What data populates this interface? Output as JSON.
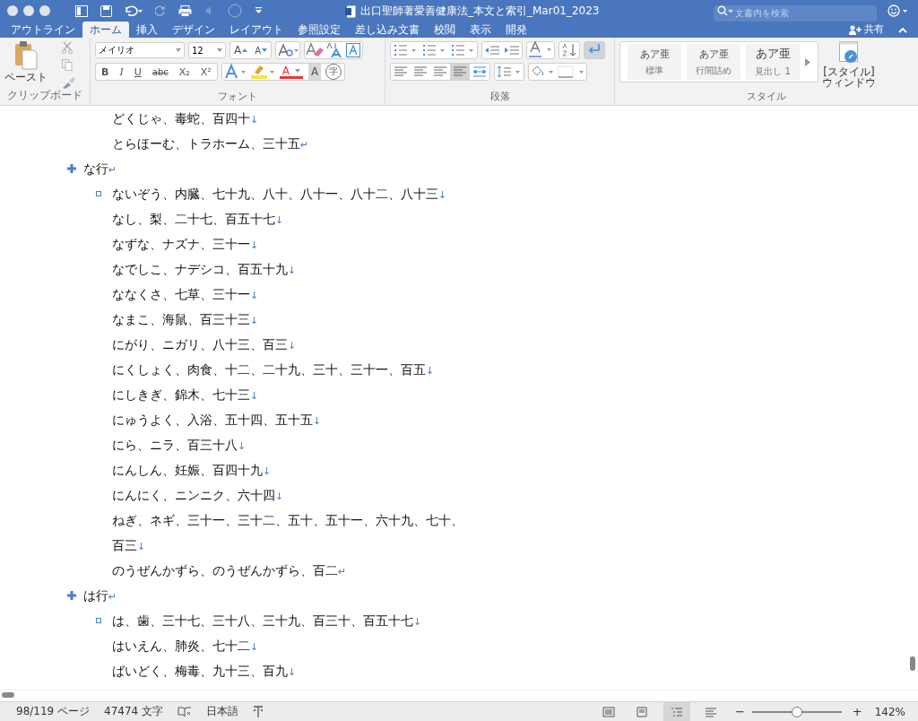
{
  "window": {
    "title": "出口聖師著愛善健康法_本文と索引_Mar01_2023",
    "search_placeholder": "文書内を検索"
  },
  "tabs": [
    {
      "label": "アウトライン",
      "selected": false
    },
    {
      "label": "ホーム",
      "selected": true
    },
    {
      "label": "挿入",
      "selected": false
    },
    {
      "label": "デザイン",
      "selected": false
    },
    {
      "label": "レイアウト",
      "selected": false
    },
    {
      "label": "参照設定",
      "selected": false
    },
    {
      "label": "差し込み文書",
      "selected": false
    },
    {
      "label": "校閲",
      "selected": false
    },
    {
      "label": "表示",
      "selected": false
    },
    {
      "label": "開発",
      "selected": false
    }
  ],
  "share": "共有",
  "ribbon": {
    "clipboard": {
      "paste": "ペースト",
      "label": "クリップボード"
    },
    "font": {
      "name": "メイリオ",
      "size": "12",
      "grow": "A",
      "shrink": "A",
      "buttons": [
        "B",
        "I",
        "U",
        "abc",
        "X₂",
        "X²"
      ],
      "color_a": "A",
      "shade_a": "A",
      "enclose": "字",
      "label": "フォント"
    },
    "paragraph": {
      "label": "段落"
    },
    "styles": {
      "items": [
        {
          "preview": "あア亜",
          "name": "標準"
        },
        {
          "preview": "あア亜",
          "name": "行間詰め"
        },
        {
          "preview": "あア亜",
          "name": "見出し 1"
        }
      ],
      "label": "スタイル",
      "window_lines": [
        "[スタイル]",
        "ウィンドウ"
      ]
    }
  },
  "document": {
    "sections": [
      {
        "items": [
          {
            "text": "どくじゃ、毒蛇、百四十",
            "mark": "↓"
          },
          {
            "text": "とらほーむ、トラホーム、三十五",
            "mark": "↵"
          }
        ]
      },
      {
        "heading": {
          "text": "な行",
          "mark": "↵"
        },
        "items": [
          {
            "text": "ないぞう、内臓、七十九、八十、八十一、八十二、八十三",
            "mark": "↓"
          },
          {
            "text": "なし、梨、二十七、百五十七",
            "mark": "↓"
          },
          {
            "text": "なずな、ナズナ、三十一",
            "mark": "↓"
          },
          {
            "text": "なでしこ、ナデシコ、百五十九",
            "mark": "↓"
          },
          {
            "text": "ななくさ、七草、三十一",
            "mark": "↓"
          },
          {
            "text": "なまこ、海鼠、百三十三",
            "mark": "↓"
          },
          {
            "text": "にがり、ニガリ、八十三、百三",
            "mark": "↓"
          },
          {
            "text": "にくしょく、肉食、十二、二十九、三十、三十一、百五",
            "mark": "↓"
          },
          {
            "text": "にしきぎ、錦木、七十三",
            "mark": "↓"
          },
          {
            "text": "にゅうよく、入浴、五十四、五十五",
            "mark": "↓"
          },
          {
            "text": "にら、ニラ、百三十八",
            "mark": "↓"
          },
          {
            "text": "にんしん、妊娠、百四十九",
            "mark": "↓"
          },
          {
            "text": "にんにく、ニンニク、六十四",
            "mark": "↓"
          },
          {
            "text": "ねぎ、ネギ、三十一、三十二、五十、五十一、六十九、七十、百三",
            "mark": "↓"
          },
          {
            "text": "のうぜんかずら、のうぜんかずら、百二",
            "mark": "↵"
          }
        ]
      },
      {
        "heading": {
          "text": "は行",
          "mark": "↵"
        },
        "items": [
          {
            "text": "は、歯、三十七、三十八、三十九、百三十、百五十七",
            "mark": "↓"
          },
          {
            "text": "はいえん、肺炎、七十二",
            "mark": "↓"
          },
          {
            "text": "ばいどく、梅毒、九十三、百九",
            "mark": "↓"
          }
        ]
      }
    ]
  },
  "status_bar": {
    "page": "98/119 ページ",
    "words": "47474 文字",
    "language": "日本語",
    "views": [
      {
        "selected": false
      },
      {
        "selected": false
      },
      {
        "selected": true
      },
      {
        "selected": false
      }
    ],
    "zoom": {
      "level": 0.5,
      "minus": "−",
      "plus": "+",
      "reading": "142%"
    }
  }
}
